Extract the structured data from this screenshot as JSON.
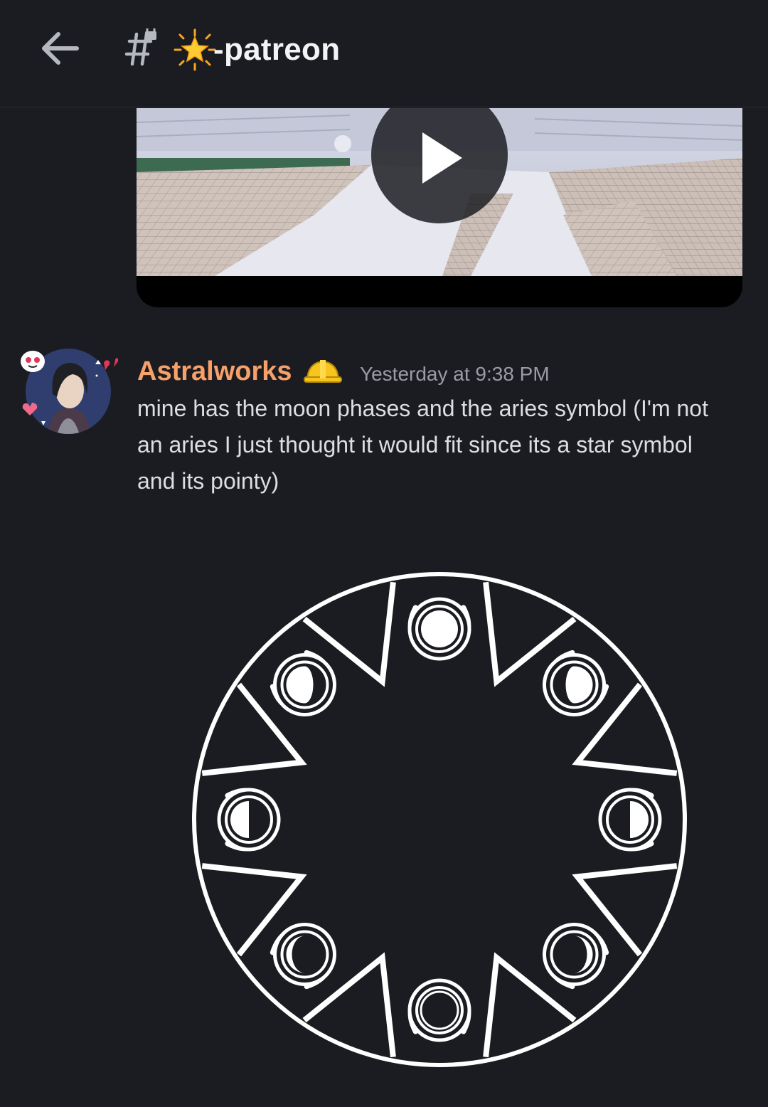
{
  "header": {
    "back_label": "Back",
    "channel_name": "-patreon",
    "channel_emoji": "glowing-star",
    "channel_locked": true
  },
  "video": {
    "play_label": "Play"
  },
  "message": {
    "username": "Astralworks",
    "username_color": "#f7a06a",
    "role_icon": "hardhat-icon",
    "timestamp": "Yesterday at 9:38 PM",
    "text": "mine has the moon phases and the aries symbol (I'm not an aries I just thought it would fit since its a star symbol and its pointy)"
  },
  "attachment": {
    "description_icon": "moon-phase-ring-image"
  },
  "colors": {
    "background": "#1b1c21",
    "text": "#dcdee3",
    "muted": "#9a9ca4",
    "accent_orange": "#f7a06a"
  }
}
